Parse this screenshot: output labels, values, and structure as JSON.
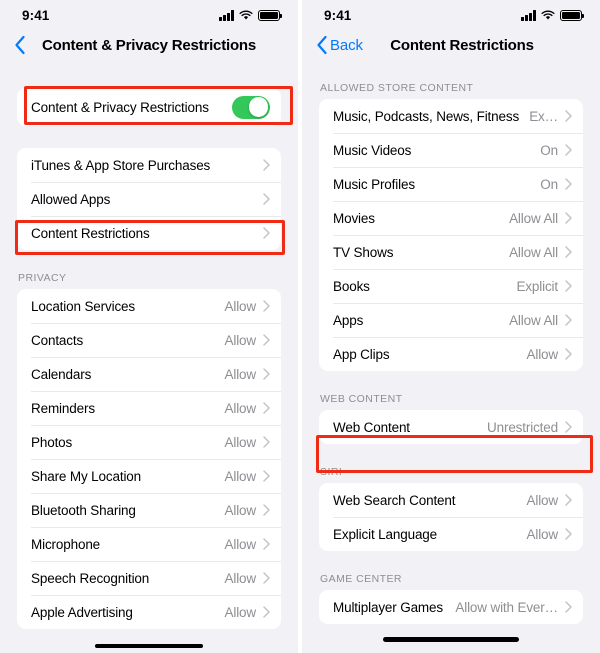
{
  "left_screen": {
    "statusbar": {
      "time": "9:41",
      "icons": [
        "cellular-bars-icon",
        "wifi-icon",
        "battery-icon"
      ]
    },
    "nav": {
      "back_icon": "chevron-left-icon",
      "back_label": "",
      "title": "Content & Privacy Restrictions"
    },
    "master_toggle": {
      "label": "Content & Privacy Restrictions",
      "state": "on",
      "highlighted": true
    },
    "menu_group": {
      "items": [
        {
          "label": "iTunes & App Store Purchases",
          "value": "",
          "highlighted": false
        },
        {
          "label": "Allowed Apps",
          "value": "",
          "highlighted": false
        },
        {
          "label": "Content Restrictions",
          "value": "",
          "highlighted": true
        }
      ]
    },
    "privacy_group": {
      "header": "PRIVACY",
      "items": [
        {
          "label": "Location Services",
          "value": "Allow"
        },
        {
          "label": "Contacts",
          "value": "Allow"
        },
        {
          "label": "Calendars",
          "value": "Allow"
        },
        {
          "label": "Reminders",
          "value": "Allow"
        },
        {
          "label": "Photos",
          "value": "Allow"
        },
        {
          "label": "Share My Location",
          "value": "Allow"
        },
        {
          "label": "Bluetooth Sharing",
          "value": "Allow"
        },
        {
          "label": "Microphone",
          "value": "Allow"
        },
        {
          "label": "Speech Recognition",
          "value": "Allow"
        },
        {
          "label": "Apple Advertising",
          "value": "Allow"
        }
      ]
    }
  },
  "right_screen": {
    "statusbar": {
      "time": "9:41",
      "icons": [
        "cellular-bars-icon",
        "wifi-icon",
        "battery-icon"
      ]
    },
    "nav": {
      "back_icon": "chevron-left-icon",
      "back_label": "Back",
      "title": "Content Restrictions"
    },
    "store_group": {
      "header": "ALLOWED STORE CONTENT",
      "items": [
        {
          "label": "Music, Podcasts, News, Fitness",
          "value": "Ex…"
        },
        {
          "label": "Music Videos",
          "value": "On"
        },
        {
          "label": "Music Profiles",
          "value": "On"
        },
        {
          "label": "Movies",
          "value": "Allow All"
        },
        {
          "label": "TV Shows",
          "value": "Allow All"
        },
        {
          "label": "Books",
          "value": "Explicit"
        },
        {
          "label": "Apps",
          "value": "Allow All"
        },
        {
          "label": "App Clips",
          "value": "Allow"
        }
      ]
    },
    "web_group": {
      "header": "WEB CONTENT",
      "items": [
        {
          "label": "Web Content",
          "value": "Unrestricted",
          "highlighted": true
        }
      ]
    },
    "siri_group": {
      "header": "SIRI",
      "items": [
        {
          "label": "Web Search Content",
          "value": "Allow"
        },
        {
          "label": "Explicit Language",
          "value": "Allow"
        }
      ]
    },
    "game_center_group": {
      "header": "GAME CENTER",
      "items": [
        {
          "label": "Multiplayer Games",
          "value": "Allow with Ever…"
        }
      ]
    }
  },
  "colors": {
    "highlight": "#ef2b16",
    "toggle_on": "#34c759",
    "accent": "#007aff",
    "page_bg": "#f2f1f6",
    "card_bg": "#ffffff",
    "secondary_text": "#8e8e93"
  }
}
